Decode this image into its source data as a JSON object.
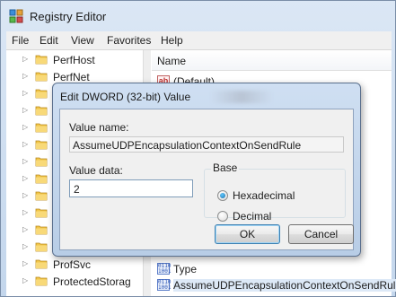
{
  "window": {
    "title": "Registry Editor"
  },
  "menu": [
    "File",
    "Edit",
    "View",
    "Favorites",
    "Help"
  ],
  "tree": {
    "items": [
      {
        "label": "PerfHost"
      },
      {
        "label": "PerfNet"
      },
      {
        "label": ""
      },
      {
        "label": ""
      },
      {
        "label": ""
      },
      {
        "label": ""
      },
      {
        "label": ""
      },
      {
        "label": ""
      },
      {
        "label": ""
      },
      {
        "label": ""
      },
      {
        "label": ""
      },
      {
        "label": ""
      },
      {
        "label": "ProfSvc"
      },
      {
        "label": "ProtectedStorag"
      }
    ]
  },
  "values_pane": {
    "column_name": "Name",
    "rows": [
      {
        "label": "(Default)",
        "icon": "string-value-icon"
      },
      {
        "label": "Type",
        "icon": "dword-value-icon"
      },
      {
        "label": "AssumeUDPEncapsulationContextOnSendRule",
        "icon": "dword-value-icon"
      }
    ]
  },
  "dialog": {
    "title": "Edit DWORD (32-bit) Value",
    "value_name_label": "Value name:",
    "value_name": "AssumeUDPEncapsulationContextOnSendRule",
    "value_data_label": "Value data:",
    "value_data": "2",
    "base_label": "Base",
    "hex_label": "Hexadecimal",
    "dec_label": "Decimal",
    "selected_base": "Hexadecimal",
    "ok_label": "OK",
    "cancel_label": "Cancel"
  }
}
